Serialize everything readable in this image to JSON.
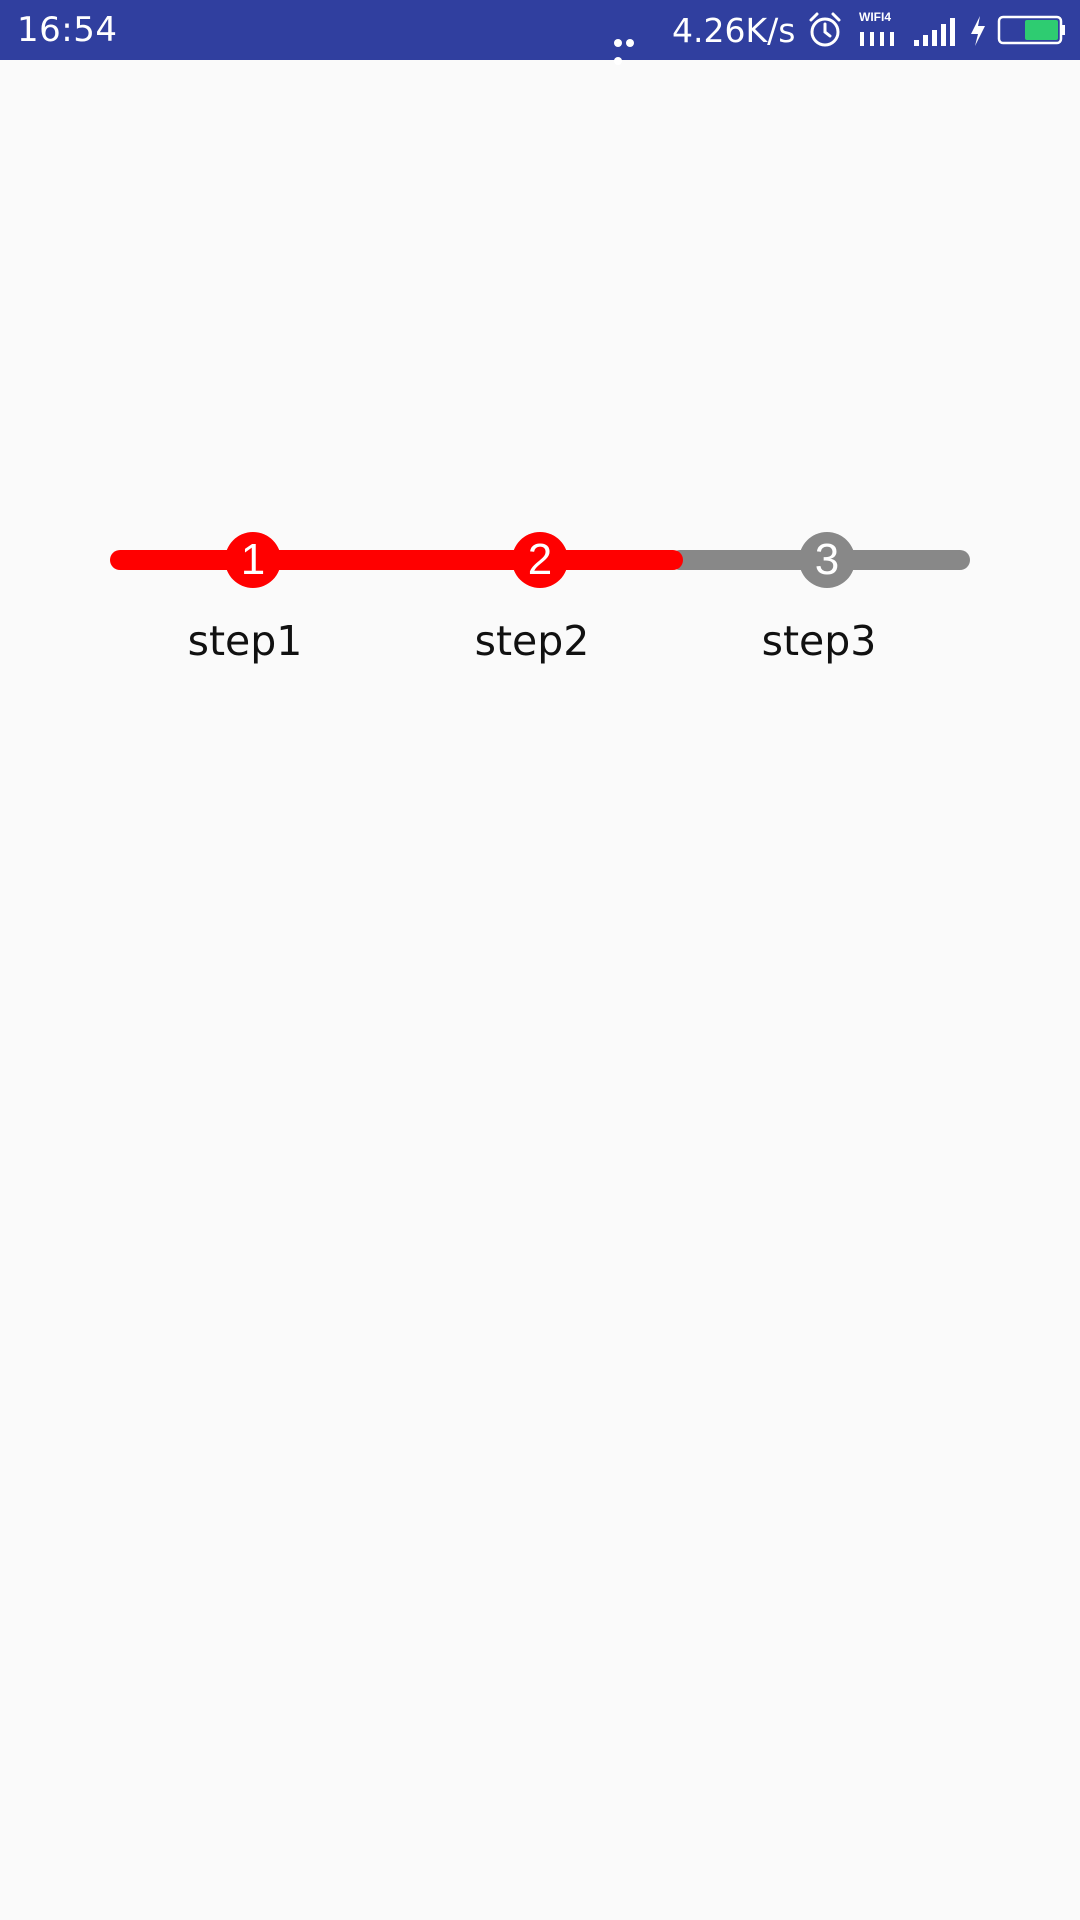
{
  "status_bar": {
    "time": "16:54",
    "net_speed": "4.26K/s",
    "wifi_label": "WIFI4",
    "icons": [
      "more-dots-icon",
      "alarm-icon",
      "wifi-icon",
      "signal-icon",
      "charging-icon",
      "battery-icon"
    ],
    "background_color": "#303f9f",
    "battery_fill_color": "#2ecc71"
  },
  "stepper": {
    "active_color": "#ff0000",
    "inactive_color": "#888888",
    "current_step": 2,
    "steps": [
      {
        "number": "1",
        "label": "step1",
        "state": "done"
      },
      {
        "number": "2",
        "label": "step2",
        "state": "done"
      },
      {
        "number": "3",
        "label": "step3",
        "state": "todo"
      }
    ]
  }
}
